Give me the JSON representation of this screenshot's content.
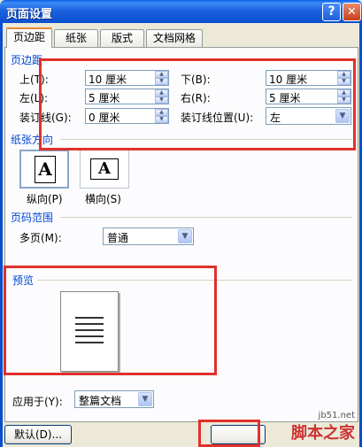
{
  "window": {
    "title": "页面设置",
    "help_label": "?",
    "close_label": "✕"
  },
  "tabs": [
    {
      "label": "页边距"
    },
    {
      "label": "纸张"
    },
    {
      "label": "版式"
    },
    {
      "label": "文档网格"
    }
  ],
  "margins": {
    "section_title": "页边距",
    "top_label": "上(T):",
    "top_value": "10 厘米",
    "bottom_label": "下(B):",
    "bottom_value": "10 厘米",
    "left_label": "左(L):",
    "left_value": "5 厘米",
    "right_label": "右(R):",
    "right_value": "5 厘米",
    "gutter_label": "装订线(G):",
    "gutter_value": "0 厘米",
    "gutter_pos_label": "装订线位置(U):",
    "gutter_pos_value": "左"
  },
  "orientation": {
    "section_title": "纸张方向",
    "portrait_label": "纵向(P)",
    "landscape_label": "横向(S)",
    "glyph": "A"
  },
  "pages": {
    "section_title": "页码范围",
    "multiple_label": "多页(M):",
    "multiple_value": "普通"
  },
  "preview": {
    "section_title": "预览"
  },
  "apply": {
    "label": "应用于(Y):",
    "value": "整篇文档"
  },
  "buttons": {
    "default_label": "默认(D)..."
  },
  "watermark": {
    "site": "jb51.net",
    "brand": "脚本之家"
  },
  "colors": {
    "section": "#0046d5",
    "highlight": "#e0312b",
    "titlebar": "#0a4fd0"
  },
  "icons": {
    "spin_up": "▲",
    "spin_down": "▼",
    "dropdown": "▼"
  }
}
